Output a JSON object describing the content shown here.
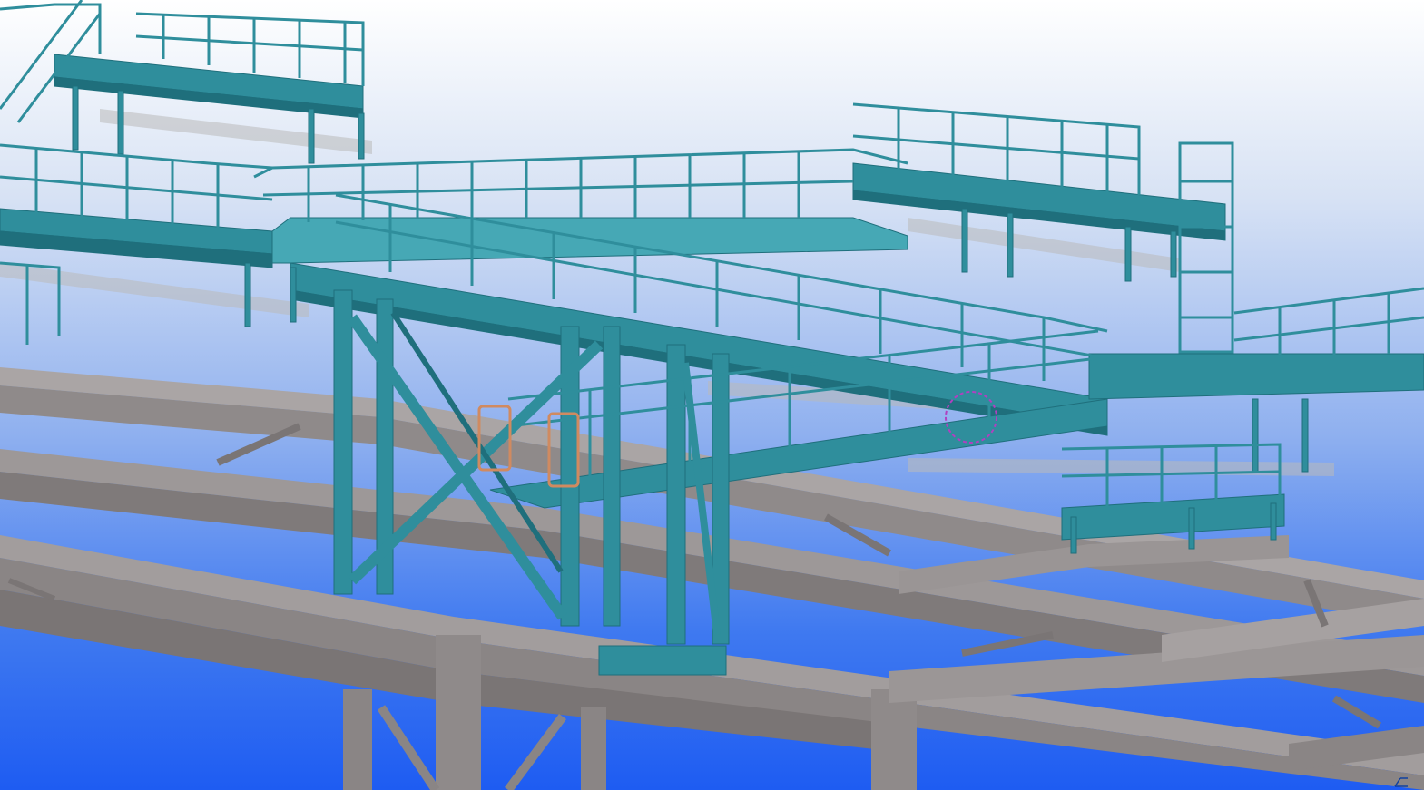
{
  "viewport": {
    "background_top": "#ffffff",
    "background_bottom": "#1e5cf2"
  },
  "colors": {
    "steel_grey": "#8f8a8a",
    "steel_grey_dark": "#6e6969",
    "steel_grey_light": "#aaa5a5",
    "platform_teal": "#2f8e9c",
    "platform_teal_dark": "#1f6f7c",
    "platform_teal_light": "#46a8b5",
    "ghost_grey": "#b9b9b9",
    "highlight_magenta": "#b040c0",
    "orange_rail": "#d08a60",
    "axis_blue": "#1040a0"
  },
  "icons": {
    "axis": "xyz-axis-icon"
  }
}
